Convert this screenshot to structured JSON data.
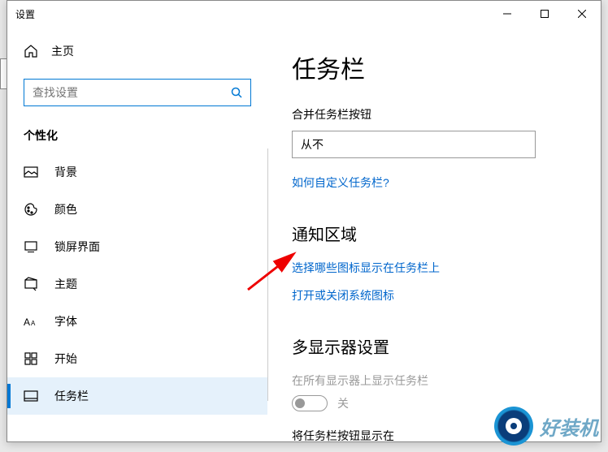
{
  "window": {
    "title": "设置"
  },
  "sidebar": {
    "home_label": "主页",
    "search_placeholder": "查找设置",
    "section": "个性化",
    "items": [
      {
        "label": "背景",
        "icon": "picture-icon"
      },
      {
        "label": "颜色",
        "icon": "palette-icon"
      },
      {
        "label": "锁屏界面",
        "icon": "lockscreen-icon"
      },
      {
        "label": "主题",
        "icon": "theme-icon"
      },
      {
        "label": "字体",
        "icon": "font-icon"
      },
      {
        "label": "开始",
        "icon": "start-icon"
      },
      {
        "label": "任务栏",
        "icon": "taskbar-icon",
        "active": true
      }
    ]
  },
  "main": {
    "title": "任务栏",
    "combine_label": "合并任务栏按钮",
    "combine_value": "从不",
    "customize_link": "如何自定义任务栏?",
    "notification_heading": "通知区域",
    "select_icons_link": "选择哪些图标显示在任务栏上",
    "system_icons_link": "打开或关闭系统图标",
    "multi_heading": "多显示器设置",
    "multi_show_label": "在所有显示器上显示任务栏",
    "toggle_state": "关",
    "multi_where_label": "将任务栏按钮显示在"
  },
  "overlay": {
    "logo_text": "好装机"
  }
}
